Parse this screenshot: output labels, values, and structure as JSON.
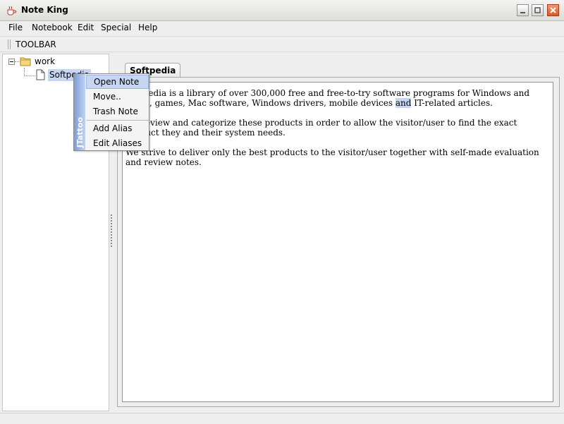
{
  "window": {
    "title": "Note King",
    "icons": {
      "app": "coffee-cup-icon",
      "minimize": "minimize-icon",
      "maximize": "maximize-icon",
      "close": "close-icon"
    }
  },
  "menubar": [
    "File",
    "Notebook",
    "Edit",
    "Special",
    "Help"
  ],
  "toolbar": {
    "label": "TOOLBAR"
  },
  "tree": {
    "folder": {
      "label": "work",
      "icon": "folder-icon"
    },
    "note": {
      "label": "Softpedia",
      "icon": "document-icon"
    }
  },
  "tab": {
    "label": "Softpedia"
  },
  "editor": {
    "paragraphs": [
      {
        "before": "Softpedia is a library of over 300,000 free and free-to-try software programs for Windows and Linux, games, Mac software, Windows drivers, mobile devices ",
        "highlight": "and",
        "after": " IT-related articles."
      },
      {
        "text": "We review and categorize these products in order to allow the visitor/user to find the exact product they and their system needs."
      },
      {
        "text": "We strive to deliver only the best products to the visitor/user together with self-made evaluation and review notes."
      }
    ]
  },
  "context_menu": {
    "side_label": "JTattoo",
    "items": [
      "Open Note",
      "Move..",
      "Trash Note",
      "Add Alias",
      "Edit Aliases"
    ]
  },
  "colors": {
    "selection": "#c6d6f2",
    "close_button": "#d45a2c",
    "menu_sidebar": "#7f9dd6"
  }
}
